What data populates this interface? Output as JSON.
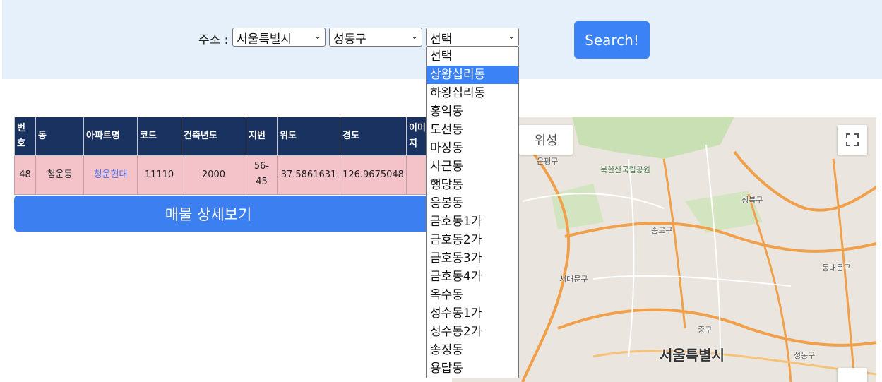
{
  "search": {
    "address_label": "주소 :",
    "city_value": "서울특별시",
    "gu_value": "성동구",
    "dong_value": "선택",
    "button_label": "Search!"
  },
  "dong_options": [
    "선택",
    "상왕십리동",
    "하왕십리동",
    "홍익동",
    "도선동",
    "마장동",
    "사근동",
    "행당동",
    "응봉동",
    "금호동1가",
    "금호동2가",
    "금호동3가",
    "금호동4가",
    "옥수동",
    "성수동1가",
    "성수동2가",
    "송정동",
    "용답동"
  ],
  "dong_highlighted_index": 1,
  "table": {
    "headers": [
      "번호",
      "동",
      "아파트명",
      "코드",
      "건축년도",
      "지번",
      "위도",
      "경도",
      "이미지"
    ],
    "rows": [
      [
        "48",
        "청운동",
        "청운현대",
        "11110",
        "2000",
        "56-45",
        "37.5861631",
        "126.9675048",
        ""
      ]
    ]
  },
  "detail_button_label": "매물 상세보기",
  "map": {
    "type_toggle_label": "위성",
    "labels": [
      "은평구",
      "북한산국립공원",
      "성북구",
      "종로구",
      "동대문구",
      "서대문구",
      "중구",
      "서울특별시",
      "성동구"
    ],
    "colors": {
      "road": "#f0a04b",
      "park": "#c9dfb4",
      "land": "#eae6df"
    }
  }
}
